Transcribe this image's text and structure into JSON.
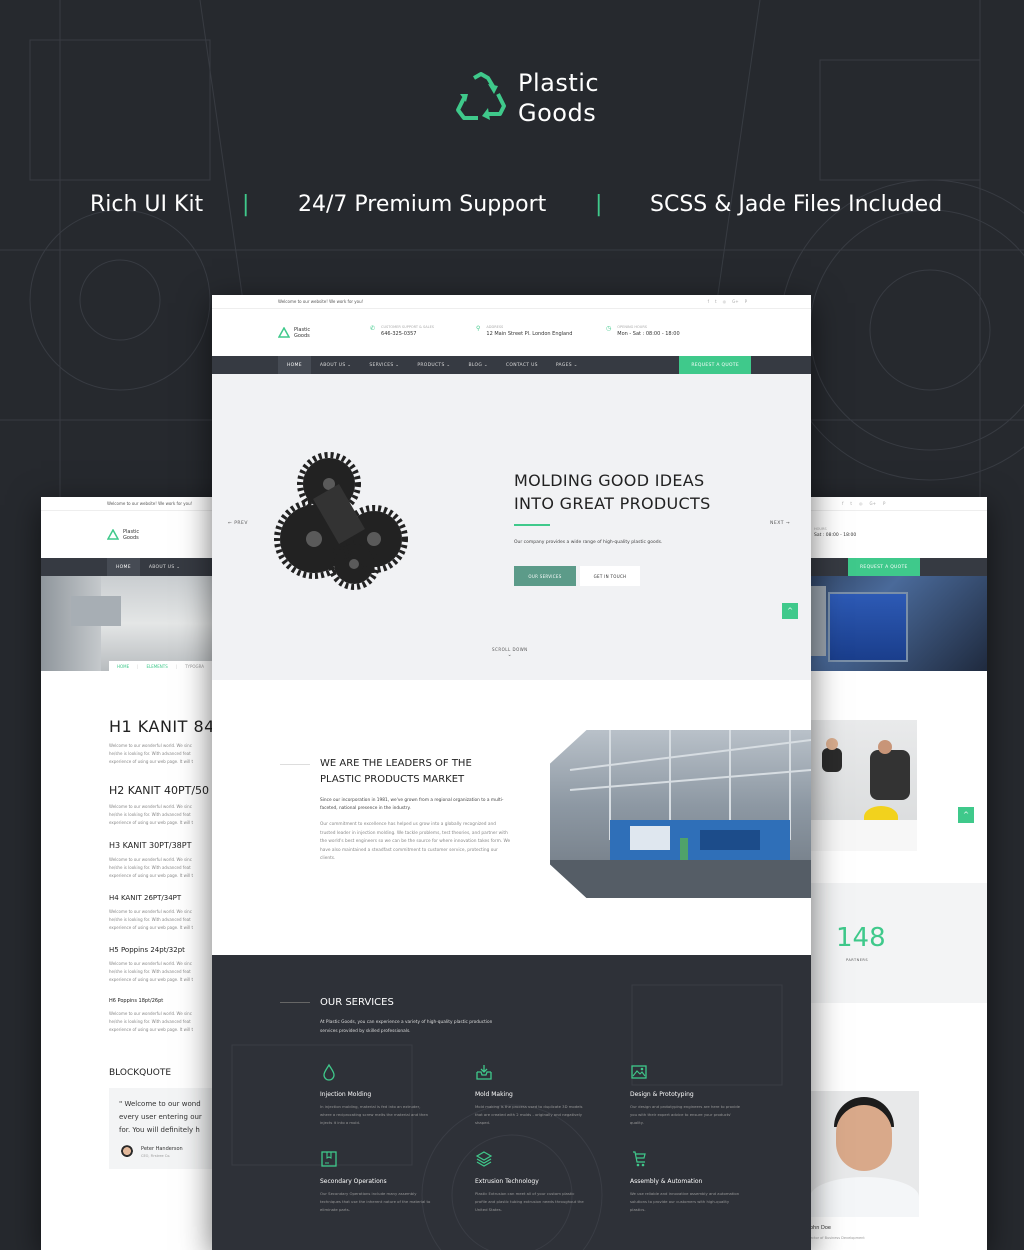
{
  "brand": {
    "line1": "Plastic",
    "line2": "Goods",
    "accent": "#3fc98b",
    "icon": "recycle-icon"
  },
  "features": [
    "Rich UI Kit",
    "|",
    "24/7 Premium Support",
    "|",
    "SCSS & Jade Files Included"
  ],
  "topbar": {
    "welcome": "Welcome to our website! We work for you!",
    "social_icons": [
      "f",
      "t",
      "◎",
      "G+",
      "P"
    ]
  },
  "header": {
    "support": {
      "label": "CUSTOMER SUPPORT & SALES",
      "value": "646-325-0357"
    },
    "address": {
      "label": "ADDRESS",
      "value": "12 Main Street Pl. London England"
    },
    "hours": {
      "label": "OPENING HOURS",
      "value": "Mon - Sat : 08:00 - 18:00",
      "label_partial": "HOURS",
      "value_partial": "Sat : 08:00 - 18:00"
    }
  },
  "nav": {
    "items": [
      "HOME",
      "ABOUT US ⌄",
      "SERVICES ⌄",
      "PRODUCTS ⌄",
      "BLOG ⌄",
      "CONTACT US",
      "PAGES ⌄"
    ],
    "left_items": [
      "HOME",
      "ABOUT US ⌄"
    ],
    "quote": "REQUEST A QUOTE"
  },
  "hero": {
    "title_line1": "MOLDING GOOD IDEAS",
    "title_line2": "INTO GREAT PRODUCTS",
    "text": "Our company provides a wide range of high-quality plastic goods.",
    "primary_btn": "OUR SERVICES",
    "secondary_btn": "GET IN TOUCH",
    "prev": "PREV",
    "next": "NEXT",
    "scroll": "SCROLL DOWN"
  },
  "about": {
    "title_line1": "WE ARE THE LEADERS OF THE",
    "title_line2": "PLASTIC PRODUCTS MARKET",
    "para1": "Since our incorporation in 1981, we've grown from a regional organization to a multi-faceted, national presence in the industry.",
    "para2": "Our commitment to excellence has helped us grow into a globally recognized and trusted leader in injection molding. We tackle problems, test theories, and partner with the world's best engineers so we can be the source for where innovation takes form. We have also maintained a steadfast commitment to customer service, protecting our clients."
  },
  "services": {
    "title": "OUR SERVICES",
    "intro": "At Plastic Goods, you can experience a variety of high-quality plastic production services provided by skilled professionals.",
    "items": [
      {
        "title": "Injection Molding",
        "text": "In injection molding, material is fed into an extruder, where a reciprocating screw melts the material and then injects it into a mold.",
        "icon": "drop-icon"
      },
      {
        "title": "Mold Making",
        "text": "Mold making is the process used to duplicate 3D models that are created with 2 molds - originally and negatively shaped.",
        "icon": "tray-icon"
      },
      {
        "title": "Design & Prototyping",
        "text": "Our design and prototyping engineers are here to provide you with their expert advice to ensure your products' quality.",
        "icon": "picture-icon"
      },
      {
        "title": "Secondary Operations",
        "text": "Our Secondary Operations include many assembly techniques that use the inherent nature of the material to eliminate parts.",
        "icon": "box-icon"
      },
      {
        "title": "Extrusion Technology",
        "text": "Plastic Extrusion can meet all of your custom plastic profile and plastic tubing extrusion needs throughout the United States.",
        "icon": "layers-icon"
      },
      {
        "title": "Assembly & Automation",
        "text": "We use reliable and innovative assembly and automation solutions to provide our customers with high-quality plastics.",
        "icon": "cart-icon"
      }
    ]
  },
  "typography": {
    "breadcrumb": [
      "HOME",
      "ELEMENTS",
      "TYPOGRA"
    ],
    "h1": "H1 KANIT 84",
    "h2": "H2 KANIT 40PT/50",
    "h3": "H3 KANIT 30PT/38PT",
    "h4": "H4 KANIT 26PT/34PT",
    "h5": "H5 Poppins 24pt/32pt",
    "h6": "H6 Poppins 18pt/26pt",
    "lorem_line1": "Welcome to our wonderful world. We sinc",
    "lorem_line2": "he/she is looking for. With advanced feat",
    "lorem_line3": "experience of using our web page. It will t",
    "blockquote_title": "BLOCKQUOTE",
    "quote_line1": "\" Welcome to our wond",
    "quote_line2": "every user entering our",
    "quote_line3": "for. You will definitely h",
    "author": "Peter Handerson",
    "author_role": "CEO, Firstree Co."
  },
  "right": {
    "count": "148",
    "count_label": "PARTNERS",
    "person": "ohn Doe",
    "person_role": "ector of Business Development"
  }
}
